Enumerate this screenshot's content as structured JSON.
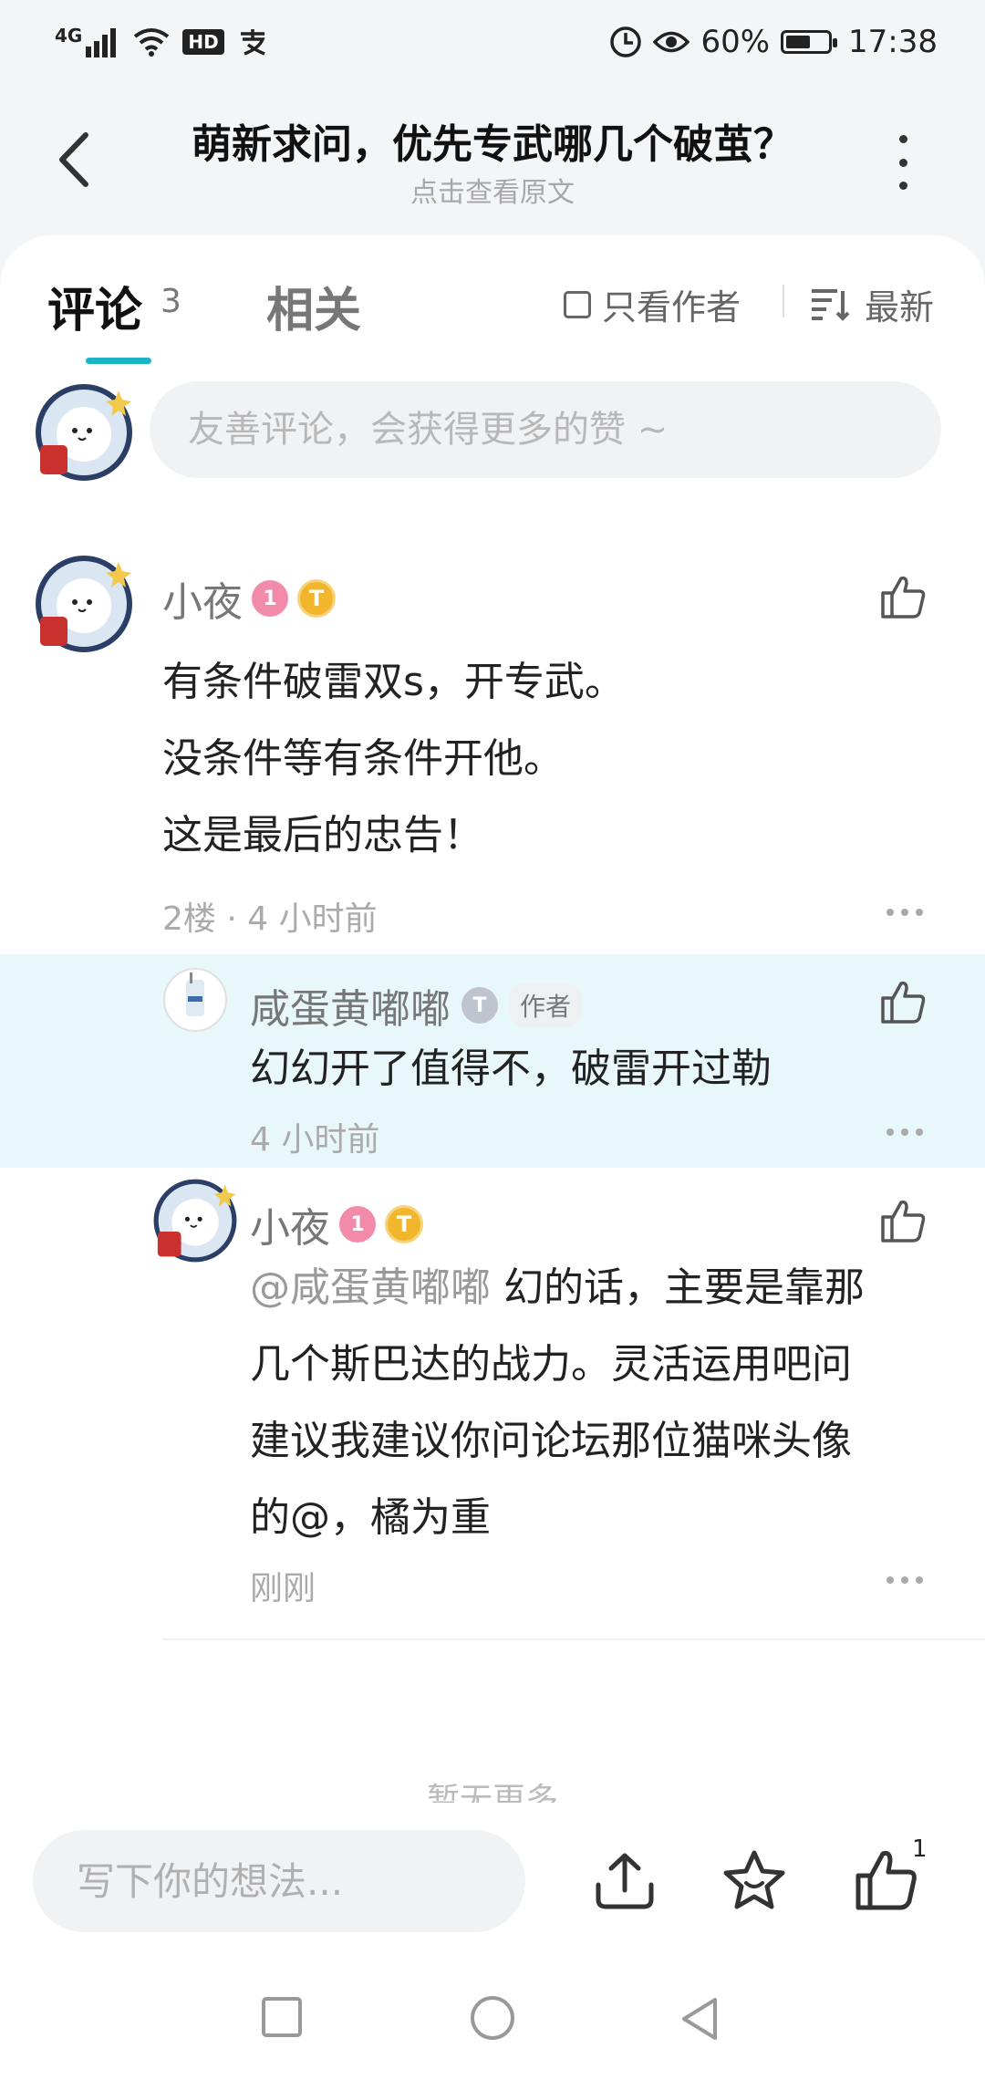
{
  "status_bar": {
    "network": "4G",
    "hd": "HD",
    "battery_text": "60%",
    "battery_level": 0.6,
    "time": "17:38"
  },
  "header": {
    "title": "萌新求问，优先专武哪几个破茧？",
    "subtitle": "点击查看原文"
  },
  "tabs": {
    "comments_label": "评论",
    "comments_count": "3",
    "related_label": "相关",
    "only_author_label": "只看作者",
    "sort_label": "最新"
  },
  "comment_input": {
    "placeholder": "友善评论，会获得更多的赞 ~"
  },
  "comments": [
    {
      "user": "小夜",
      "lines": [
        "有条件破雷双s，开专武。",
        "没条件等有条件开他。",
        "这是最后的忠告！"
      ],
      "meta": "2楼 · 4 小时前",
      "replies": [
        {
          "user": "咸蛋黄嘟嘟",
          "tag": "作者",
          "text": "幻幻开了值得不，破雷开过勒",
          "meta": "4 小时前"
        },
        {
          "user": "小夜",
          "mention": "@咸蛋黄嘟嘟",
          "lines": [
            " 幻的话，主要是靠那",
            "几个斯巴达的战力。灵活运用吧问",
            "建议我建议你问论坛那位猫咪头像",
            "的@，橘为重"
          ],
          "meta": "刚刚"
        }
      ]
    }
  ],
  "load_more": "暂无更多",
  "bottom_bar": {
    "placeholder": "写下你的想法...",
    "like_count": "1"
  },
  "colors": {
    "accent": "#1ab4c4",
    "highlight": "#e8f7f9"
  }
}
